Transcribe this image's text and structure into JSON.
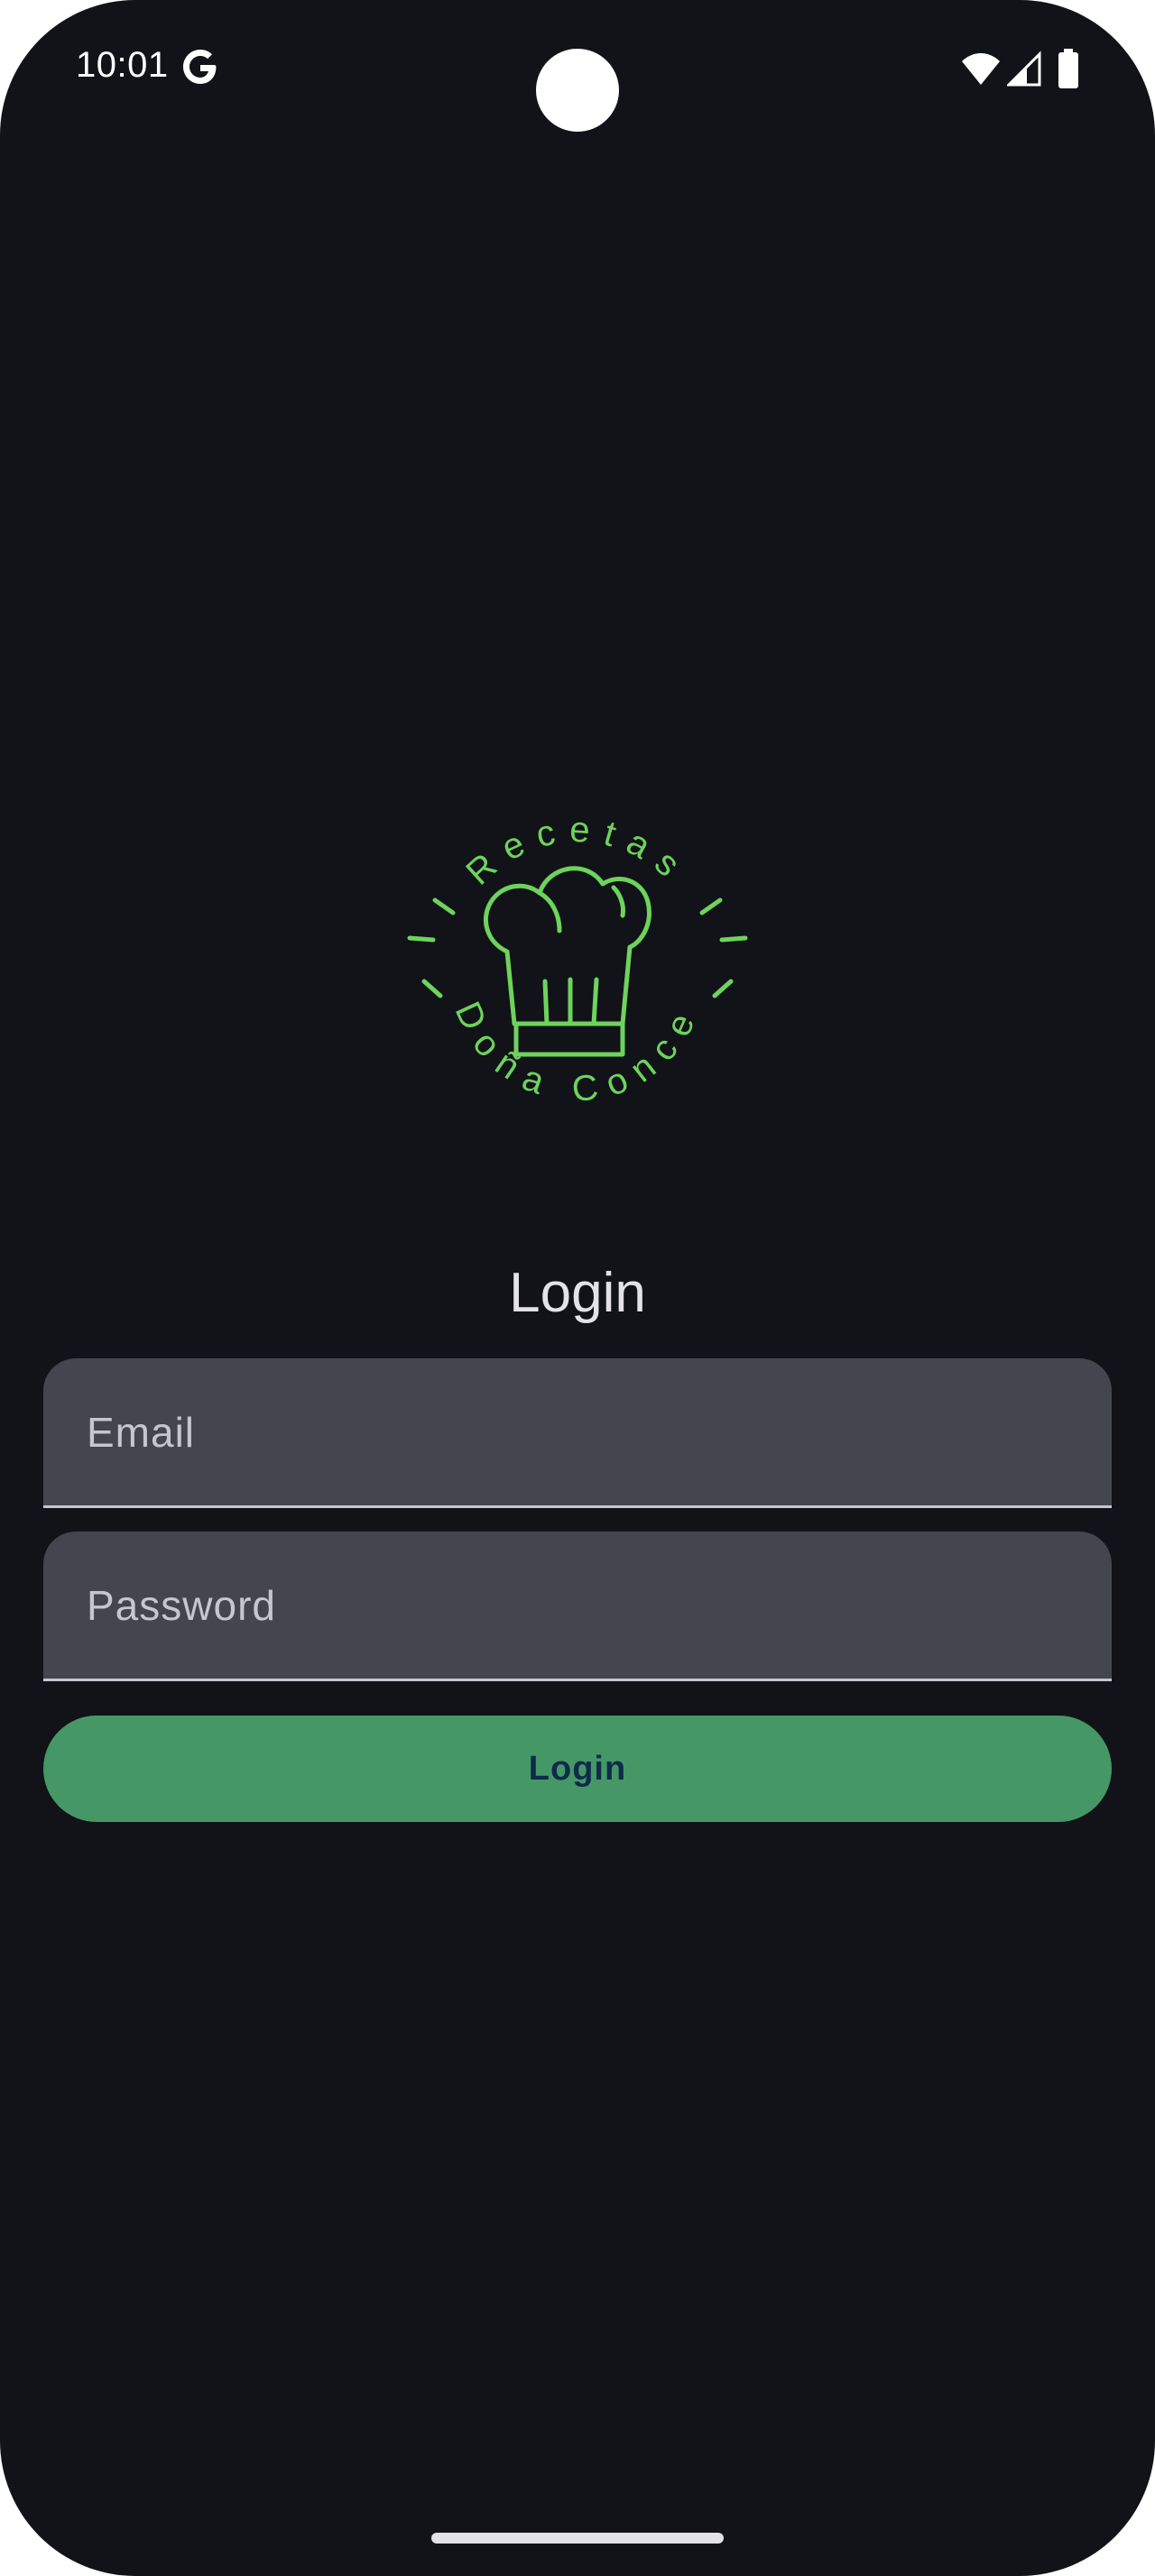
{
  "status_bar": {
    "time": "10:01",
    "icons": [
      "google-icon",
      "wifi-icon",
      "signal-icon",
      "battery-icon"
    ]
  },
  "logo": {
    "top_text": "Recetas",
    "bottom_text": "Doña Conce",
    "icon": "chef-hat-icon",
    "color": "#6ed35c"
  },
  "login_form": {
    "title": "Login",
    "email_placeholder": "Email",
    "password_placeholder": "Password",
    "submit_label": "Login"
  },
  "colors": {
    "background": "#111318",
    "field_background": "#43464f",
    "button_background": "#459866",
    "button_text": "#0f2a4a",
    "logo_green": "#6ed35c"
  }
}
